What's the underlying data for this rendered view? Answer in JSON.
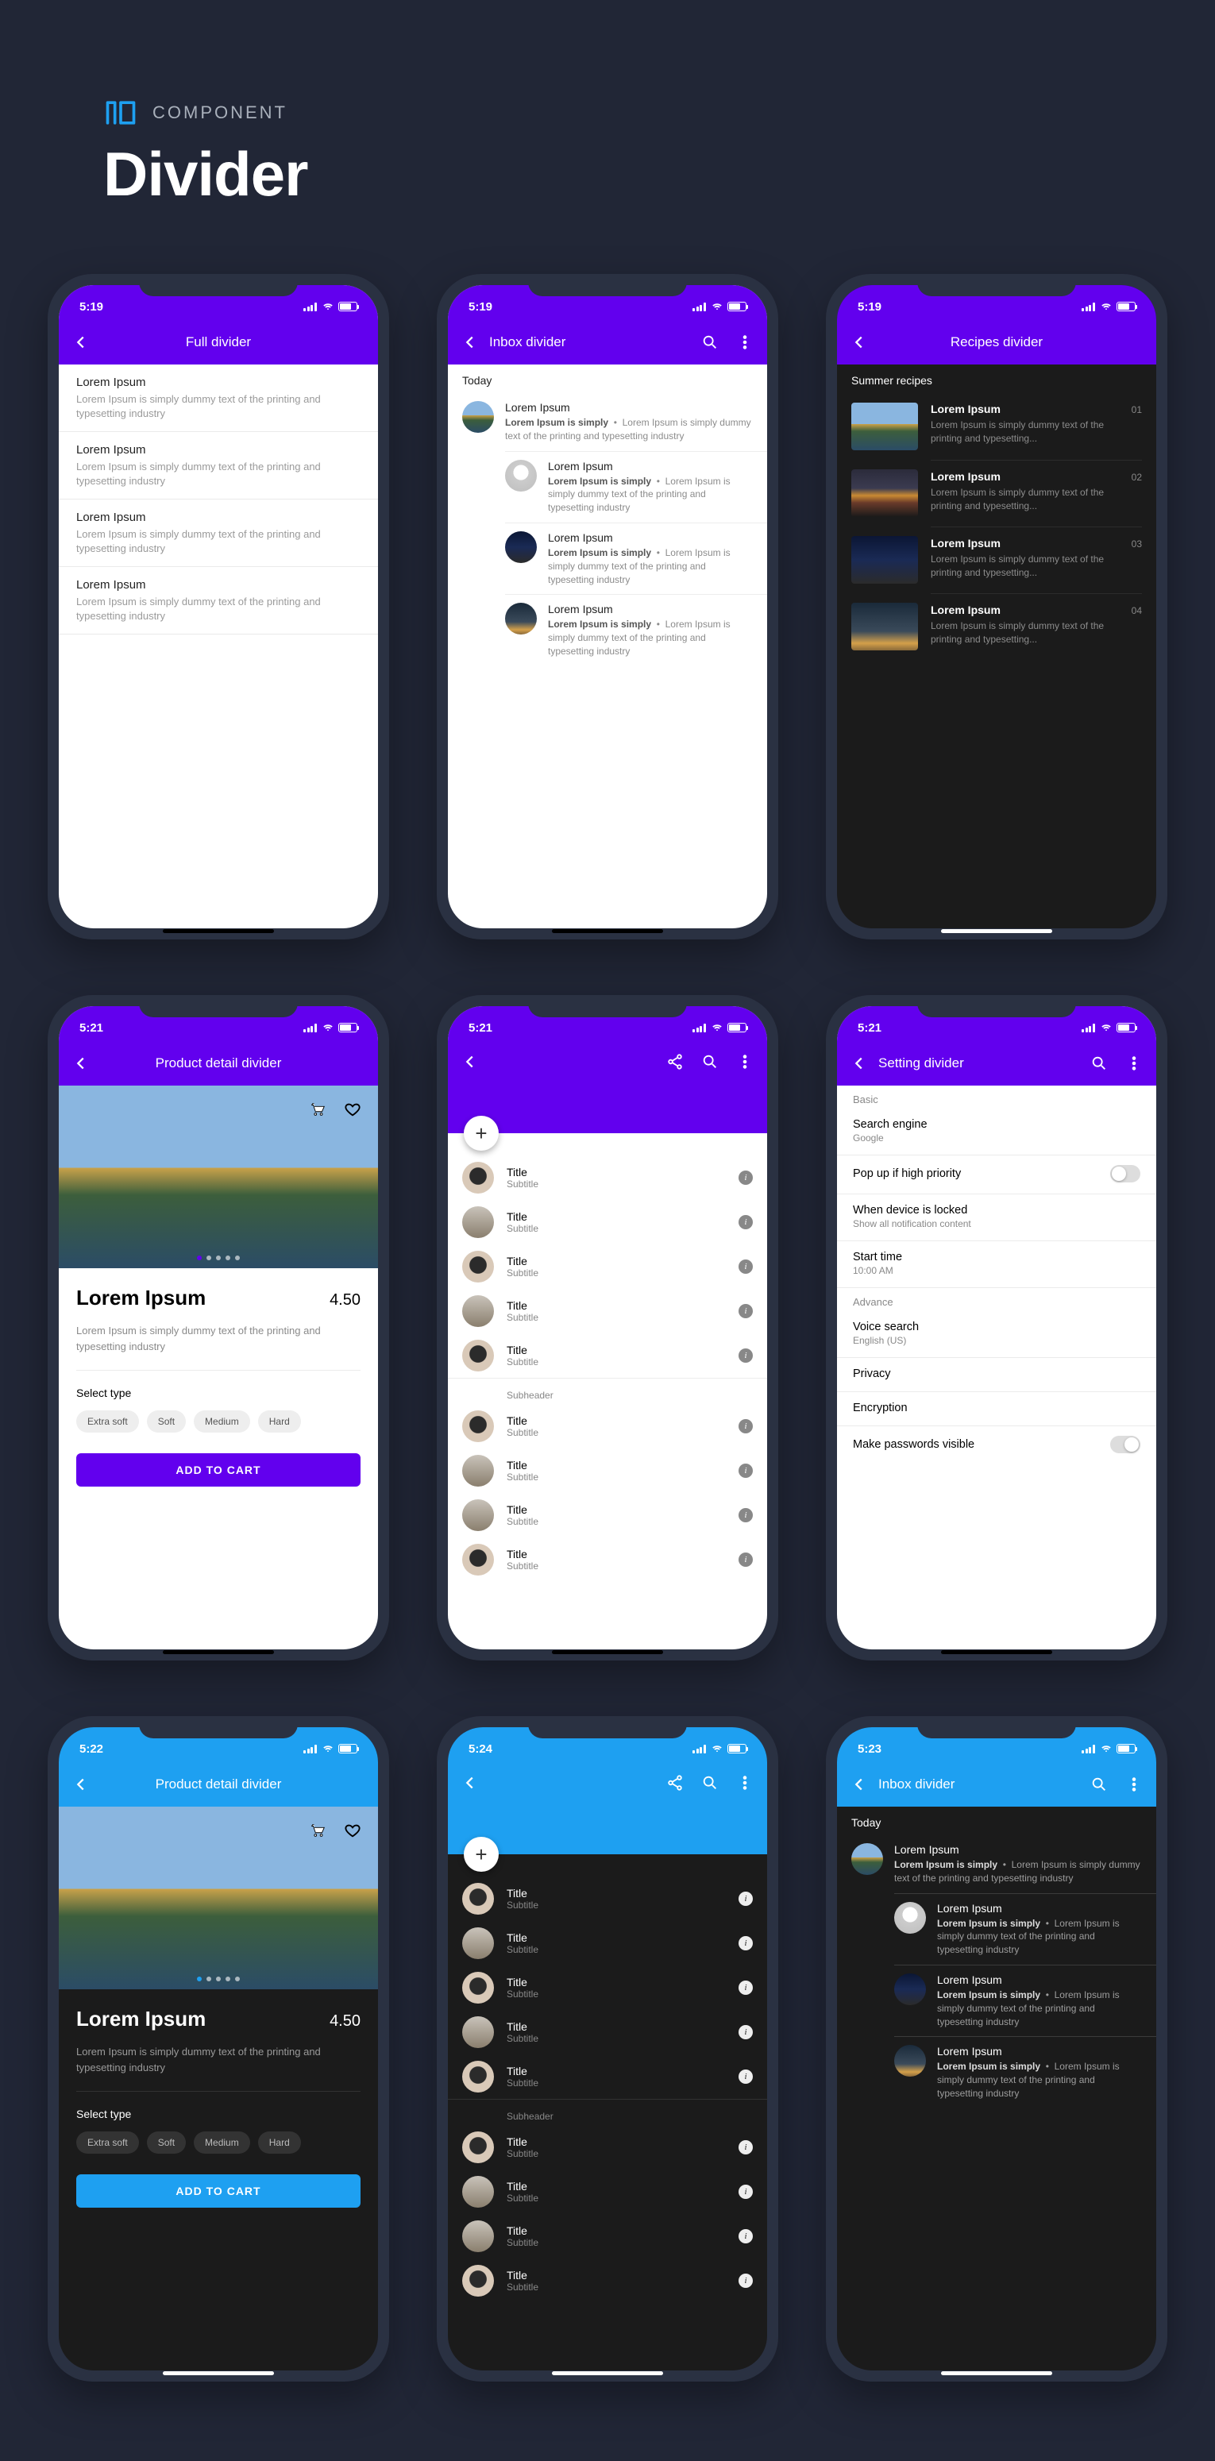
{
  "header": {
    "brand": "COMPONENT",
    "title": "Divider"
  },
  "full": {
    "time": "5:19",
    "title": "Full divider",
    "items": [
      {
        "t": "Lorem Ipsum",
        "d": "Lorem Ipsum is simply dummy text of the printing and typesetting industry"
      },
      {
        "t": "Lorem Ipsum",
        "d": "Lorem Ipsum is simply dummy text of the printing and typesetting industry"
      },
      {
        "t": "Lorem Ipsum",
        "d": "Lorem Ipsum is simply dummy text of the printing and typesetting industry"
      },
      {
        "t": "Lorem Ipsum",
        "d": "Lorem Ipsum is simply dummy text of the printing and typesetting industry"
      }
    ]
  },
  "inbox": {
    "time": "5:19",
    "title": "Inbox divider",
    "section": "Today",
    "lead": "Lorem Ipsum is simply",
    "tail": "Lorem Ipsum is simply dummy text of the printing and typesetting industry",
    "items": [
      {
        "t": "Lorem Ipsum"
      },
      {
        "t": "Lorem Ipsum"
      },
      {
        "t": "Lorem Ipsum"
      },
      {
        "t": "Lorem Ipsum"
      }
    ]
  },
  "recipes": {
    "time": "5:19",
    "title": "Recipes divider",
    "section": "Summer recipes",
    "desc": "Lorem Ipsum is simply dummy text of the printing and typesetting...",
    "items": [
      {
        "t": "Lorem Ipsum",
        "n": "01"
      },
      {
        "t": "Lorem Ipsum",
        "n": "02"
      },
      {
        "t": "Lorem Ipsum",
        "n": "03"
      },
      {
        "t": "Lorem Ipsum",
        "n": "04"
      }
    ]
  },
  "product": {
    "time_light": "5:21",
    "time_dark": "5:22",
    "title": "Product detail divider",
    "name": "Lorem Ipsum",
    "price": "4.50",
    "desc": "Lorem Ipsum is simply dummy text of the printing and typesetting industry",
    "select": "Select type",
    "chips": [
      "Extra soft",
      "Soft",
      "Medium",
      "Hard"
    ],
    "cta": "ADD TO CART"
  },
  "contacts": {
    "time_light": "5:21",
    "time_dark": "5:24",
    "title": "Title",
    "subtitle": "Subtitle",
    "subheader": "Subheader"
  },
  "settings": {
    "time": "5:21",
    "title": "Setting divider",
    "sec_basic": "Basic",
    "sec_adv": "Advance",
    "rows": {
      "search_engine": {
        "t": "Search engine",
        "s": "Google"
      },
      "popup": {
        "t": "Pop up if high priority"
      },
      "locked": {
        "t": "When device is locked",
        "s": "Show all notification content"
      },
      "start": {
        "t": "Start time",
        "s": "10:00 AM"
      },
      "voice": {
        "t": "Voice search",
        "s": "English (US)"
      },
      "privacy": {
        "t": "Privacy"
      },
      "encryption": {
        "t": "Encryption"
      },
      "pwd": {
        "t": "Make passwords visible"
      }
    }
  },
  "inbox_dark": {
    "time": "5:23"
  },
  "colors": {
    "purple": "#6200EE",
    "blue": "#1EA0F1"
  }
}
